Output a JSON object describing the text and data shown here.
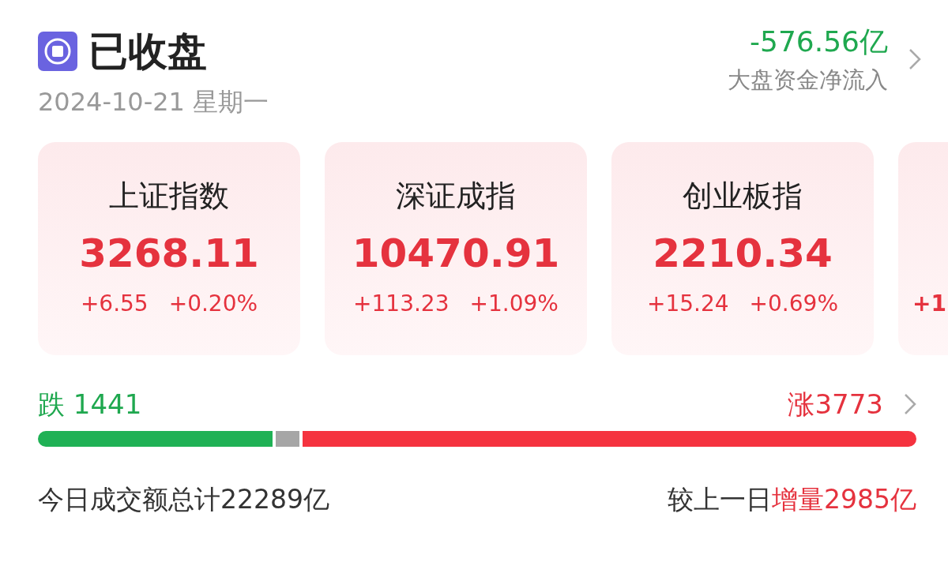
{
  "header": {
    "status": "已收盘",
    "date": "2024-10-21 星期一",
    "net_flow": {
      "value": "-576.56亿",
      "label": "大盘资金净流入"
    }
  },
  "indices": [
    {
      "kind": "full",
      "name": "上证指数",
      "value": "3268.11",
      "change": "+6.55",
      "percent": "+0.20%"
    },
    {
      "kind": "full",
      "name": "深证成指",
      "value": "10470.91",
      "change": "+113.23",
      "percent": "+1.09%"
    },
    {
      "kind": "full",
      "name": "创业板指",
      "value": "2210.34",
      "change": "+15.24",
      "percent": "+0.69%"
    },
    {
      "kind": "partial",
      "change": "+1"
    }
  ],
  "breadth": {
    "down": {
      "label": "跌",
      "count": "1441"
    },
    "up": {
      "label": "涨",
      "count": "3773"
    }
  },
  "turnover": {
    "total": "今日成交额总计22289亿",
    "compare_label": "较上一日",
    "compare_value": "增量2985亿"
  }
}
